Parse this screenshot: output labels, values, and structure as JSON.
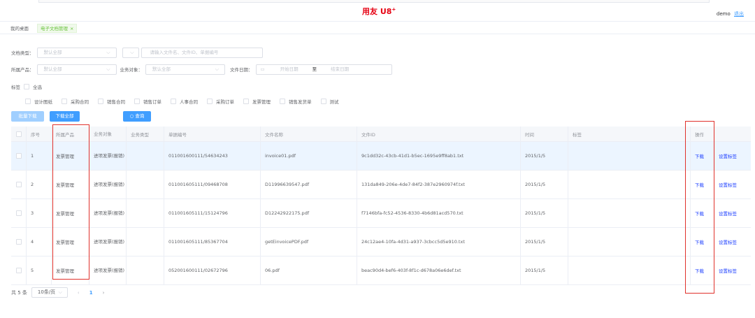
{
  "header": {
    "logo": "用友 U8",
    "logo_plus": "+",
    "user": "demo",
    "logout": "退出"
  },
  "tabs": [
    {
      "label": "我的桌面"
    },
    {
      "label": "电子文档管理",
      "close": "×"
    }
  ],
  "filters": {
    "doc_type_label": "文档类型：",
    "doc_type_value": "默认全部",
    "search_placeholder": "请输入文件名、文件ID、单据编号",
    "product_label": "所属产品：",
    "product_value": "默认全部",
    "biz_object_label": "业务对象：",
    "biz_object_value": "默认全部",
    "date_label": "文件日期：",
    "start_date": "开始日期",
    "date_sep": "至",
    "end_date": "结束日期",
    "tag_label": "标签",
    "select_all": "全选",
    "tags": [
      "设计图纸",
      "采购合同",
      "销售合同",
      "销售订单",
      "人事合同",
      "采购订单",
      "发票管理",
      "销售发货单",
      "测试"
    ]
  },
  "buttons": {
    "batch_download": "批量下载",
    "download_all": "下载全部",
    "search": "查询"
  },
  "table": {
    "columns": [
      "序号",
      "所属产品",
      "业务对象",
      "业务类型",
      "单据编号",
      "文件名称",
      "文件ID",
      "时间",
      "标签",
      "操作"
    ],
    "rows": [
      {
        "no": "1",
        "product": "发票管理",
        "object": "进项发票(报销)",
        "type": "",
        "doc_no": "011001600111/54634243",
        "file": "invoice01.pdf",
        "file_id": "9c1dd32c-43cb-41d1-b5ec-1695e9ff8ab1.txt",
        "date": "2015/1/5",
        "tag": "",
        "download": "下载",
        "set_tag": "设置标签"
      },
      {
        "no": "2",
        "product": "发票管理",
        "object": "进项发票(报销)",
        "type": "",
        "doc_no": "011001605111/09468708",
        "file": "D11996639547.pdf",
        "file_id": "131da849-206e-4de7-84f2-387e2960974f.txt",
        "date": "2015/1/5",
        "tag": "",
        "download": "下载",
        "set_tag": "设置标签"
      },
      {
        "no": "3",
        "product": "发票管理",
        "object": "进项发票(报销)",
        "type": "",
        "doc_no": "011001605111/15124796",
        "file": "D12242922175.pdf",
        "file_id": "f7146bfa-fc52-4536-8330-4b6d81acd570.txt",
        "date": "2015/1/5",
        "tag": "",
        "download": "下载",
        "set_tag": "设置标签"
      },
      {
        "no": "4",
        "product": "发票管理",
        "object": "进项发票(报销)",
        "type": "",
        "doc_no": "011001605111/85367704",
        "file": "getEinvoicePDF.pdf",
        "file_id": "24c12ae4-10fa-4d31-a937-3cbcc5d5e910.txt",
        "date": "2015/1/5",
        "tag": "",
        "download": "下载",
        "set_tag": "设置标签"
      },
      {
        "no": "5",
        "product": "发票管理",
        "object": "进项发票(报销)",
        "type": "",
        "doc_no": "052001600111/02672796",
        "file": "06.pdf",
        "file_id": "beac90d4-bef6-403f-8f1c-d678a06e6def.txt",
        "date": "2015/1/5",
        "tag": "",
        "download": "下载",
        "set_tag": "设置标签"
      }
    ]
  },
  "pager": {
    "total": "共 5 条",
    "page_size": "10条/页",
    "current": "1"
  },
  "colors": {
    "accent": "#409eff",
    "link": "#1e40ff",
    "logo": "#e60012",
    "highlight_box": "#e0312b",
    "active_tab": "#67c23a"
  }
}
